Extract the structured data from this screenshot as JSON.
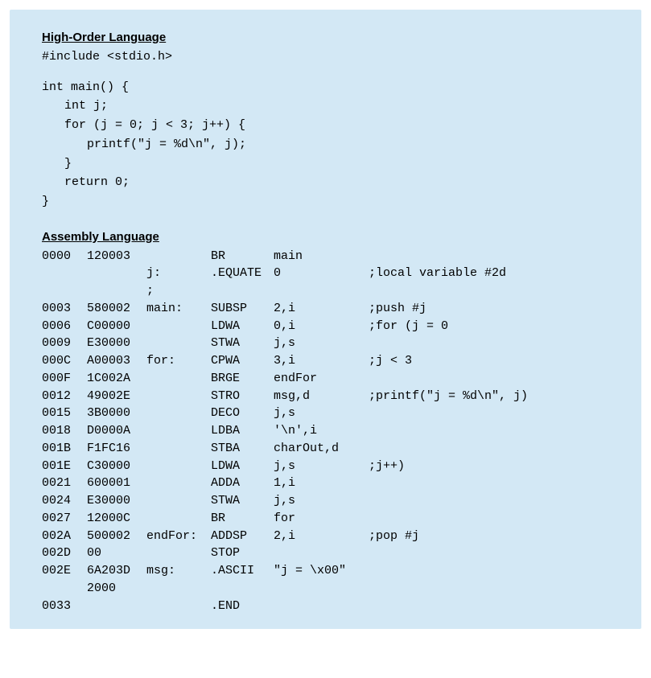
{
  "section1": {
    "heading": "High-Order Language",
    "lines": [
      {
        "text": "#include <stdio.h>",
        "indent": ""
      },
      {
        "text": "",
        "indent": ""
      },
      {
        "text": "int main() {",
        "indent": ""
      },
      {
        "text": "int j;",
        "indent": "i1"
      },
      {
        "text": "for (j = 0; j < 3; j++) {",
        "indent": "i1"
      },
      {
        "text": "printf(\"j = %d\\n\", j);",
        "indent": "i2"
      },
      {
        "text": "}",
        "indent": "i1"
      },
      {
        "text": "return 0;",
        "indent": "i1"
      },
      {
        "text": "}",
        "indent": ""
      }
    ]
  },
  "section2": {
    "heading": "Assembly Language",
    "rows": [
      {
        "addr": "0000",
        "code": "120003",
        "label": "",
        "mnemonic": "BR",
        "operand": "main",
        "comment": ""
      },
      {
        "addr": "",
        "code": "",
        "label": "j:",
        "mnemonic": ".EQUATE",
        "operand": "0",
        "comment": ";local variable #2d"
      },
      {
        "addr": "",
        "code": "",
        "label": ";",
        "mnemonic": "",
        "operand": "",
        "comment": ""
      },
      {
        "addr": "0003",
        "code": "580002",
        "label": "main:",
        "mnemonic": "SUBSP",
        "operand": "2,i",
        "comment": ";push #j"
      },
      {
        "addr": "0006",
        "code": "C00000",
        "label": "",
        "mnemonic": "LDWA",
        "operand": "0,i",
        "comment": ";for (j = 0"
      },
      {
        "addr": "0009",
        "code": "E30000",
        "label": "",
        "mnemonic": "STWA",
        "operand": "j,s",
        "comment": ""
      },
      {
        "addr": "000C",
        "code": "A00003",
        "label": "for:",
        "mnemonic": "CPWA",
        "operand": "3,i",
        "comment": ";j < 3"
      },
      {
        "addr": "000F",
        "code": "1C002A",
        "label": "",
        "mnemonic": "BRGE",
        "operand": "endFor",
        "comment": ""
      },
      {
        "addr": "0012",
        "code": "49002E",
        "label": "",
        "mnemonic": "STRO",
        "operand": "msg,d",
        "comment": ";printf(\"j = %d\\n\", j)"
      },
      {
        "addr": "0015",
        "code": "3B0000",
        "label": "",
        "mnemonic": "DECO",
        "operand": "j,s",
        "comment": ""
      },
      {
        "addr": "0018",
        "code": "D0000A",
        "label": "",
        "mnemonic": "LDBA",
        "operand": "'\\n',i",
        "comment": ""
      },
      {
        "addr": "001B",
        "code": "F1FC16",
        "label": "",
        "mnemonic": "STBA",
        "operand": "charOut,d",
        "comment": ""
      },
      {
        "addr": "001E",
        "code": "C30000",
        "label": "",
        "mnemonic": "LDWA",
        "operand": "j,s",
        "comment": ";j++)"
      },
      {
        "addr": "0021",
        "code": "600001",
        "label": "",
        "mnemonic": "ADDA",
        "operand": "1,i",
        "comment": ""
      },
      {
        "addr": "0024",
        "code": "E30000",
        "label": "",
        "mnemonic": "STWA",
        "operand": "j,s",
        "comment": ""
      },
      {
        "addr": "0027",
        "code": "12000C",
        "label": "",
        "mnemonic": "BR",
        "operand": "for",
        "comment": ""
      },
      {
        "addr": "002A",
        "code": "500002",
        "label": "endFor:",
        "mnemonic": "ADDSP",
        "operand": "2,i",
        "comment": ";pop #j"
      },
      {
        "addr": "002D",
        "code": "00",
        "label": "",
        "mnemonic": "STOP",
        "operand": "",
        "comment": ""
      },
      {
        "addr": "002E",
        "code": "6A203D",
        "label": "msg:",
        "mnemonic": ".ASCII",
        "operand": "\"j = \\x00\"",
        "comment": ""
      },
      {
        "addr": "",
        "code": "2000",
        "label": "",
        "mnemonic": "",
        "operand": "",
        "comment": ""
      },
      {
        "addr": "0033",
        "code": "",
        "label": "",
        "mnemonic": ".END",
        "operand": "",
        "comment": ""
      }
    ]
  }
}
